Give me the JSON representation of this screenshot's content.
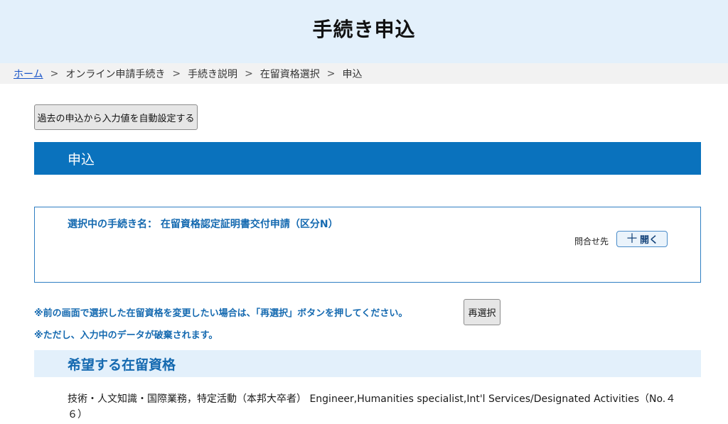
{
  "header": {
    "title": "手続き申込"
  },
  "breadcrumb": {
    "items": [
      "ホーム",
      "オンライン申請手続き",
      "手続き説明",
      "在留資格選択",
      "申込"
    ],
    "separator": ">"
  },
  "autofill": {
    "label": "過去の申込から入力値を自動設定する"
  },
  "section": {
    "title": "申込"
  },
  "procedure": {
    "label": "選択中の手続き名：",
    "name": "在留資格認定証明書交付申請（区分N）",
    "contact_label": "問合せ先",
    "open_label": "開く",
    "open_icon": "plus-icon"
  },
  "notes": {
    "line1": "※前の画面で選択した在留資格を変更したい場合は、「再選択」ボタンを押してください。",
    "line2": "※ただし、入力中のデータが破棄されます。",
    "reselect_label": "再選択"
  },
  "status": {
    "title": "希望する在留資格",
    "value": "技術・人文知識・国際業務，特定活動（本邦大卒者） Engineer,Humanities specialist,Int'l Services/Designated Activities（No.４６）"
  },
  "colors": {
    "header_bg": "#e3f0fb",
    "section_bar": "#0a72bd",
    "accent_text": "#1469b0",
    "link": "#1a55c8"
  }
}
